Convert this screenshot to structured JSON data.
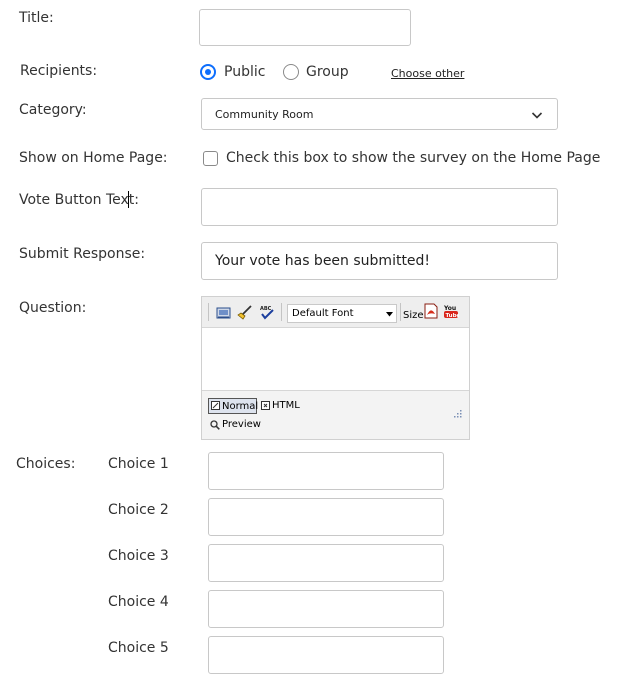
{
  "fields": {
    "title_label": "Title:",
    "title_value": "",
    "recipients_label": "Recipients:",
    "recipients_options": [
      "Public",
      "Group"
    ],
    "recipients_selected": "Public",
    "choose_other_link": "Choose other",
    "category_label": "Category:",
    "category_value": "Community Room",
    "show_home_label": "Show on Home Page:",
    "show_home_checkbox_text": "Check this box to show the survey on the Home Page",
    "show_home_checked": false,
    "vote_button_label": "Vote Button Text:",
    "vote_button_value": "",
    "submit_response_label": "Submit Response:",
    "submit_response_value": "Your vote has been submitted!",
    "question_label": "Question:"
  },
  "editor": {
    "font_select_value": "Default Font",
    "size_label": "Size",
    "modes": [
      "Normal",
      "HTML",
      "Preview"
    ],
    "active_mode": "Normal"
  },
  "choices": {
    "label": "Choices:",
    "items": [
      {
        "label": "Choice 1",
        "value": ""
      },
      {
        "label": "Choice 2",
        "value": ""
      },
      {
        "label": "Choice 3",
        "value": ""
      },
      {
        "label": "Choice 4",
        "value": ""
      },
      {
        "label": "Choice 5",
        "value": ""
      }
    ]
  },
  "colors": {
    "accent": "#0d6efd",
    "border": "#c8c8c8"
  }
}
